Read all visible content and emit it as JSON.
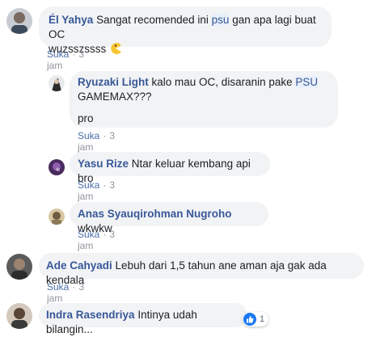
{
  "comments": [
    {
      "author": "Él Yahya",
      "text_before": "Sangat recomended ini",
      "highlight": "psu",
      "text_after": "gan apa lagi buat OC",
      "text_line2": "wuzsszssss",
      "emoji": "pacman-emoji",
      "like_label": "Suka",
      "time": "3 jam"
    },
    {
      "author": "Ryuzaki Light",
      "text_before": "kalo mau OC, disaranin pake",
      "highlight": "PSU",
      "text_line2": "GAMEMAX???",
      "text_line3": "pro",
      "like_label": "Suka",
      "time": "3 jam"
    },
    {
      "author": "Yasu Rize",
      "text": "Ntar keluar kembang api bro",
      "like_label": "Suka",
      "time": "3 jam"
    },
    {
      "author": "Anas Syauqirohman Nugroho",
      "text": "wkwkw",
      "like_label": "Suka",
      "time": "3 jam"
    },
    {
      "author": "Ade Cahyadi",
      "text": "Lebuh dari 1,5 tahun ane aman aja gak ada kendala",
      "like_label": "Suka",
      "time": "3 jam"
    },
    {
      "author": "Indra Rasendriya",
      "text": "Intinya udah bilangin...",
      "reaction_count": "1",
      "reaction_icon": "like-reaction-icon"
    }
  ],
  "colors": {
    "name": "#385898",
    "bubble": "#f2f3f5",
    "meta": "#90949c",
    "like_blue": "#1877f2"
  }
}
